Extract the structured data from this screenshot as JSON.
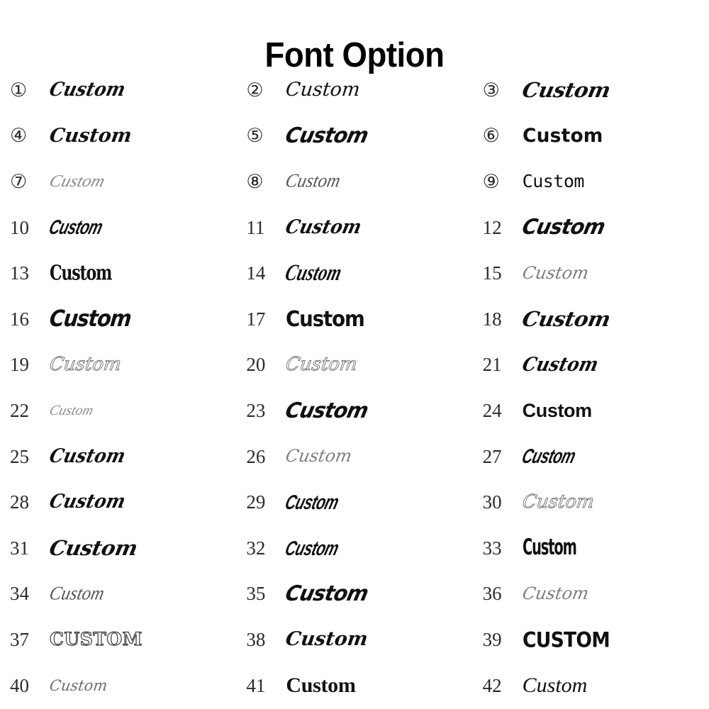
{
  "page": {
    "title": "Font Option",
    "background_color": "#ffffff",
    "text_color": "#111111"
  },
  "grid": {
    "columns": 3,
    "rows": 14,
    "total_options": 42,
    "sample_word": "Custom",
    "sample_word_uppercase": "CUSTOM",
    "numbering_note": "options 1-9 use circled numerals, 10-42 use plain numerals"
  },
  "options": [
    {
      "number": "①",
      "number_plain": "1",
      "label": "Custom",
      "style": "s-brush"
    },
    {
      "number": "②",
      "number_plain": "2",
      "label": "Custom",
      "style": "s-script-formal"
    },
    {
      "number": "③",
      "number_plain": "3",
      "label": "Custom",
      "style": "s-brush-wide"
    },
    {
      "number": "④",
      "number_plain": "4",
      "label": "Custom",
      "style": "s-script-formal-bold"
    },
    {
      "number": "⑤",
      "number_plain": "5",
      "label": "Custom",
      "style": "s-brush-heavy"
    },
    {
      "number": "⑥",
      "number_plain": "6",
      "label": "Custom",
      "style": "s-rounded-bold"
    },
    {
      "number": "⑦",
      "number_plain": "7",
      "label": "Custom",
      "style": "s-script-hairline"
    },
    {
      "number": "⑧",
      "number_plain": "8",
      "label": "Custom",
      "style": "s-script-fine"
    },
    {
      "number": "⑨",
      "number_plain": "9",
      "label": "Custom",
      "style": "s-mono-light"
    },
    {
      "number": "10",
      "number_plain": "10",
      "label": "Custom",
      "style": "s-brush-condensed"
    },
    {
      "number": "11",
      "number_plain": "11",
      "label": "Custom",
      "style": "s-brush"
    },
    {
      "number": "12",
      "number_plain": "12",
      "label": "Custom",
      "style": "s-brush-heavy"
    },
    {
      "number": "13",
      "number_plain": "13",
      "label": "Custom",
      "style": "s-blackletter"
    },
    {
      "number": "14",
      "number_plain": "14",
      "label": "Custom",
      "style": "s-brush-tall"
    },
    {
      "number": "15",
      "number_plain": "15",
      "label": "Custom",
      "style": "s-script-light-gray"
    },
    {
      "number": "16",
      "number_plain": "16",
      "label": "Custom",
      "style": "s-display-heavy-italic"
    },
    {
      "number": "17",
      "number_plain": "17",
      "label": "Custom",
      "style": "s-display-heavy"
    },
    {
      "number": "18",
      "number_plain": "18",
      "label": "Custom",
      "style": "s-brush-wide"
    },
    {
      "number": "19",
      "number_plain": "19",
      "label": "Custom",
      "style": "s-script-outline-gray"
    },
    {
      "number": "20",
      "number_plain": "20",
      "label": "Custom",
      "style": "s-script-outline-gray"
    },
    {
      "number": "21",
      "number_plain": "21",
      "label": "Custom",
      "style": "s-brush"
    },
    {
      "number": "22",
      "number_plain": "22",
      "label": "Custom",
      "style": "s-script-tiny-gray"
    },
    {
      "number": "23",
      "number_plain": "23",
      "label": "Custom",
      "style": "s-brush-heavy"
    },
    {
      "number": "24",
      "number_plain": "24",
      "label": "Custom",
      "style": "s-sans-bold"
    },
    {
      "number": "25",
      "number_plain": "25",
      "label": "Custom",
      "style": "s-brush"
    },
    {
      "number": "26",
      "number_plain": "26",
      "label": "Custom",
      "style": "s-script-light-gray"
    },
    {
      "number": "27",
      "number_plain": "27",
      "label": "Custom",
      "style": "s-brush-condensed"
    },
    {
      "number": "28",
      "number_plain": "28",
      "label": "Custom",
      "style": "s-brush"
    },
    {
      "number": "29",
      "number_plain": "29",
      "label": "Custom",
      "style": "s-brush-condensed"
    },
    {
      "number": "30",
      "number_plain": "30",
      "label": "Custom",
      "style": "s-script-outline-gray"
    },
    {
      "number": "31",
      "number_plain": "31",
      "label": "Custom",
      "style": "s-brush-wide"
    },
    {
      "number": "32",
      "number_plain": "32",
      "label": "Custom",
      "style": "s-brush-condensed"
    },
    {
      "number": "33",
      "number_plain": "33",
      "label": "Custom",
      "style": "s-gothic-condensed"
    },
    {
      "number": "34",
      "number_plain": "34",
      "label": "Custom",
      "style": "s-script-fine"
    },
    {
      "number": "35",
      "number_plain": "35",
      "label": "Custom",
      "style": "s-brush-heavy"
    },
    {
      "number": "36",
      "number_plain": "36",
      "label": "Custom",
      "style": "s-script-light-gray"
    },
    {
      "number": "37",
      "number_plain": "37",
      "label": "CUSTOM",
      "style": "s-collegiate-outline"
    },
    {
      "number": "38",
      "number_plain": "38",
      "label": "Custom",
      "style": "s-script-formal-bold"
    },
    {
      "number": "39",
      "number_plain": "39",
      "label": "CUSTOM",
      "style": "s-upper-heavy"
    },
    {
      "number": "40",
      "number_plain": "40",
      "label": "Custom",
      "style": "s-script-small"
    },
    {
      "number": "41",
      "number_plain": "41",
      "label": "Custom",
      "style": "s-serif-bold"
    },
    {
      "number": "42",
      "number_plain": "42",
      "label": "Custom",
      "style": "s-serif-italic"
    }
  ]
}
